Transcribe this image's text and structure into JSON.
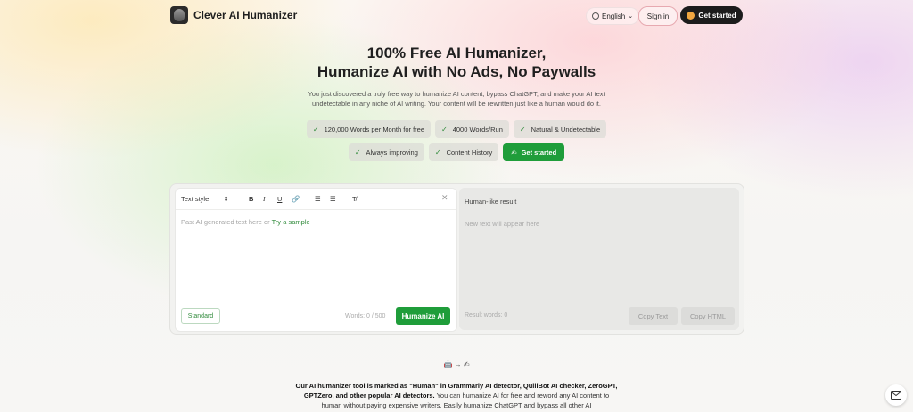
{
  "header": {
    "brand": "Clever AI Humanizer",
    "language": "English",
    "signin_label": "Sign in",
    "get_started_label": "Get started"
  },
  "hero": {
    "title_line1": "100% Free AI Humanizer,",
    "title_line2": "Humanize AI with No Ads, No Paywalls",
    "description": "You just discovered a truly free way to humanize AI content, bypass ChatGPT, and make your AI text undetectable in any niche of AI writing. Your content will be rewritten just like a human would do it.",
    "features": [
      "120,000 Words per Month for free",
      "4000 Words/Run",
      "Natural & Undetectable",
      "Always improving",
      "Content History"
    ],
    "cta_label": "Get started"
  },
  "editor": {
    "text_style_label": "Text style",
    "placeholder": "Past AI generated text here or",
    "sample_link": "Try a sample",
    "mode_label": "Standard",
    "word_count": "Words: 0 / 500",
    "humanize_label": "Humanize AI"
  },
  "result": {
    "title": "Human-like result",
    "placeholder": "New text will appear here",
    "word_count": "Result words: 0",
    "copy_text_label": "Copy Text",
    "copy_html_label": "Copy HTML"
  },
  "bottom": {
    "bold_intro": "Our AI humanizer tool is marked as \"Human\" in Grammarly AI detector, QuillBot AI checker, ZeroGPT, GPTZero, and other popular AI detectors.",
    "rest": " You can humanize AI for free and reword any AI content to human without paying expensive writers. Easily humanize ChatGPT and bypass all other AI"
  },
  "colors": {
    "accent": "#1f9d3a",
    "dark_button": "#1c1c1c"
  }
}
